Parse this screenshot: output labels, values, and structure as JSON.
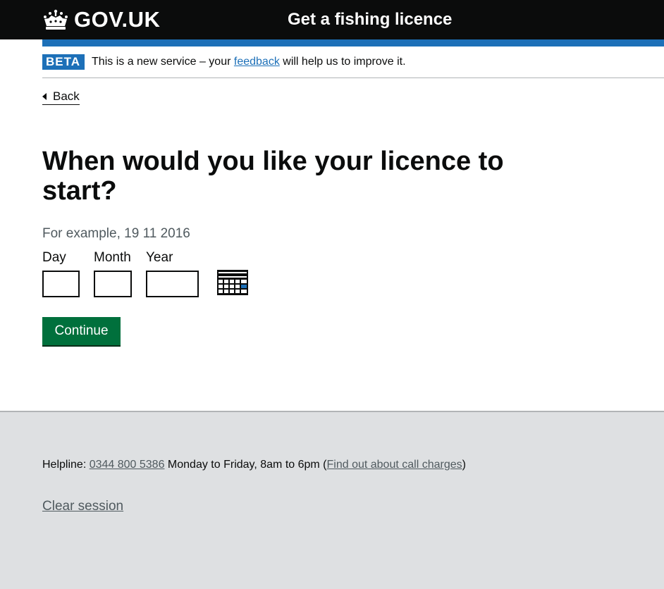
{
  "header": {
    "logo_text": "GOV.UK",
    "service_name": "Get a fishing licence"
  },
  "phase_banner": {
    "tag": "BETA",
    "text_before": "This is a new service – your ",
    "link_text": "feedback",
    "text_after": " will help us to improve it."
  },
  "back_link": "Back",
  "main": {
    "heading": "When would you like your licence to start?",
    "hint": "For example, 19 11 2016",
    "date_fields": [
      {
        "label": "Day",
        "value": ""
      },
      {
        "label": "Month",
        "value": ""
      },
      {
        "label": "Year",
        "value": ""
      }
    ],
    "continue_label": "Continue"
  },
  "footer": {
    "helpline_label": "Helpline: ",
    "phone": "0344 800 5386",
    "hours": " Monday to Friday, 8am to 6pm (",
    "call_charges_link": "Find out about call charges",
    "close_paren": ")",
    "clear_session": "Clear session"
  },
  "icons": {
    "logo": "crown-icon",
    "back": "back-arrow-icon",
    "calendar": "calendar-icon"
  },
  "colors": {
    "header_bg": "#0b0c0c",
    "accent_blue": "#1d70b8",
    "button_green": "#00703c",
    "footer_bg": "#dee0e2"
  }
}
